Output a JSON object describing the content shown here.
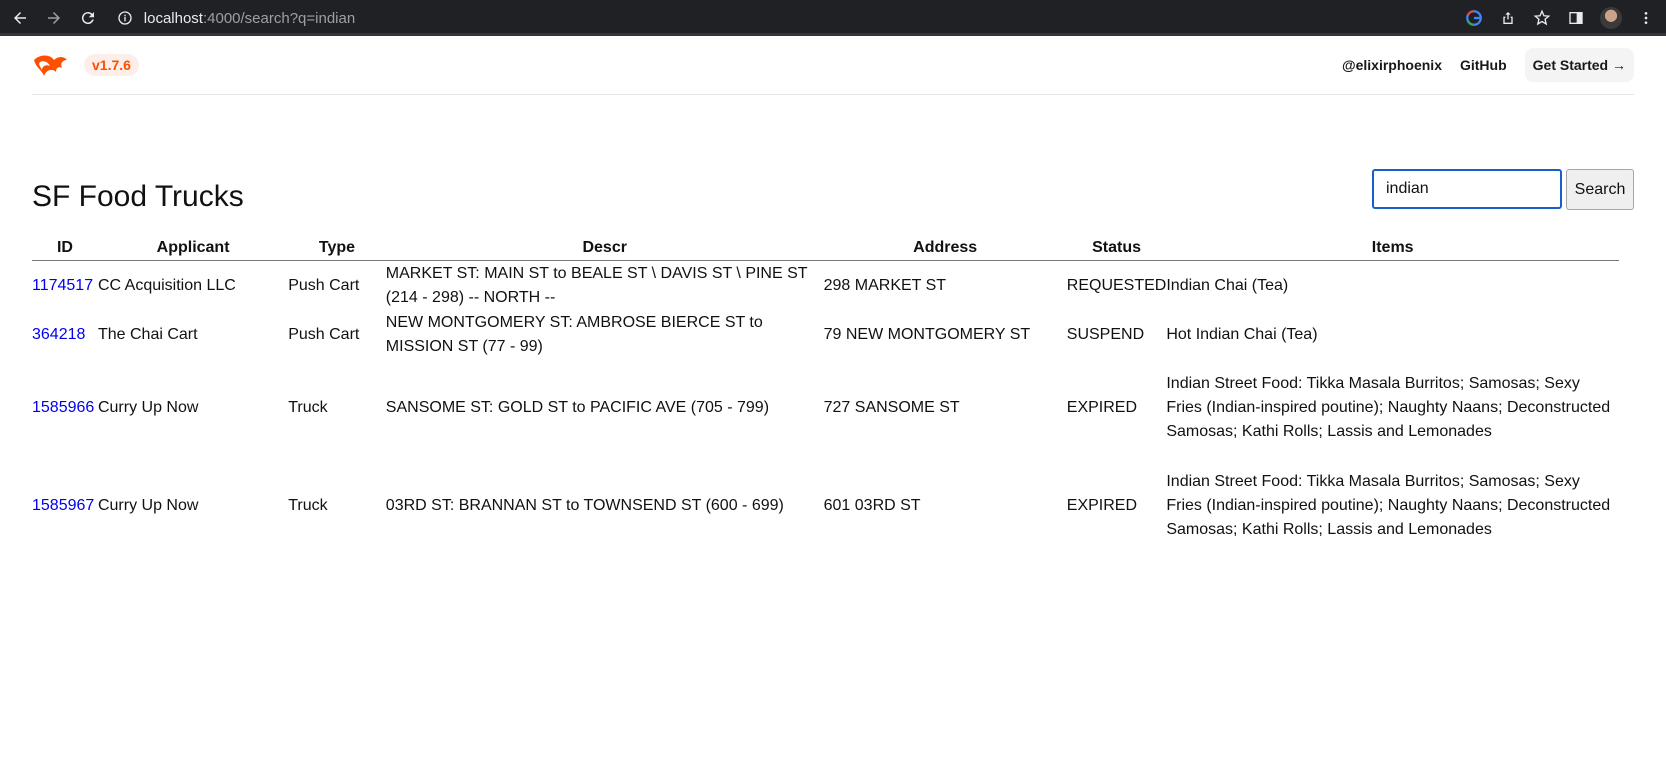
{
  "browser": {
    "url_host": "localhost",
    "url_rest": ":4000/search?q=indian"
  },
  "header": {
    "version": "v1.7.6",
    "links": [
      "@elixirphoenix",
      "GitHub"
    ],
    "get_started": "Get Started →"
  },
  "page": {
    "title": "SF Food Trucks",
    "search_value": "indian",
    "search_button": "Search"
  },
  "table": {
    "columns": [
      "ID",
      "Applicant",
      "Type",
      "Descr",
      "Address",
      "Status",
      "Items"
    ],
    "rows": [
      {
        "id": "1174517",
        "applicant": "CC Acquisition LLC",
        "type": "Push Cart",
        "descr": "MARKET ST: MAIN ST to BEALE ST \\ DAVIS ST \\ PINE ST (214 - 298) -- NORTH --",
        "address": "298 MARKET ST",
        "status": "REQUESTED",
        "items": "Indian Chai (Tea)"
      },
      {
        "id": "364218",
        "applicant": "The Chai Cart",
        "type": "Push Cart",
        "descr": "NEW MONTGOMERY ST: AMBROSE BIERCE ST to MISSION ST (77 - 99)",
        "address": "79 NEW MONTGOMERY ST",
        "status": "SUSPEND",
        "items": "Hot Indian Chai (Tea)"
      },
      {
        "id": "1585966",
        "applicant": "Curry Up Now",
        "type": "Truck",
        "descr": "SANSOME ST: GOLD ST to PACIFIC AVE (705 - 799)",
        "address": "727 SANSOME ST",
        "status": "EXPIRED",
        "items": "Indian Street Food: Tikka Masala Burritos; Samosas; Sexy Fries (Indian-inspired poutine); Naughty Naans; Deconstructed Samosas; Kathi Rolls; Lassis and Lemonades"
      },
      {
        "id": "1585967",
        "applicant": "Curry Up Now",
        "type": "Truck",
        "descr": "03RD ST: BRANNAN ST to TOWNSEND ST (600 - 699)",
        "address": "601 03RD ST",
        "status": "EXPIRED",
        "items": "Indian Street Food: Tikka Masala Burritos; Samosas; Sexy Fries (Indian-inspired poutine); Naughty Naans; Deconstructed Samosas; Kathi Rolls; Lassis and Lemonades"
      }
    ]
  }
}
